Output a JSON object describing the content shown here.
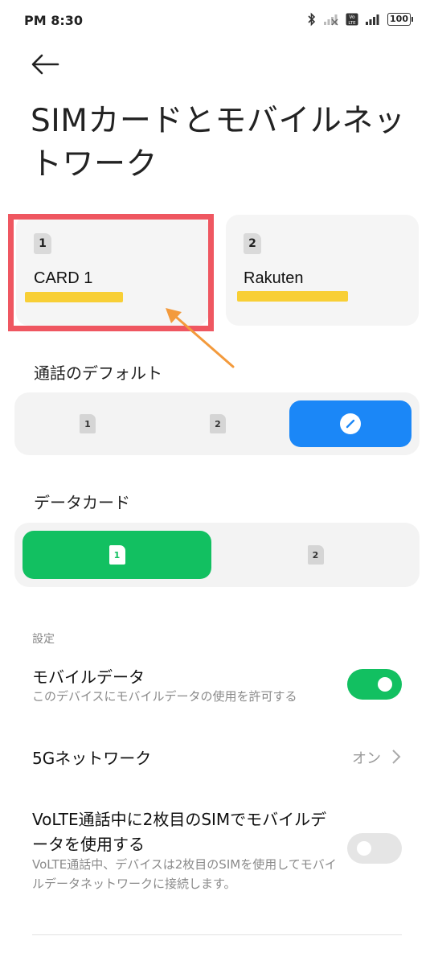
{
  "status_bar": {
    "time": "PM 8:30",
    "battery": "100"
  },
  "page": {
    "title": "SIMカードとモバイルネットワーク"
  },
  "sim_cards": [
    {
      "slot": "1",
      "name": "CARD 1"
    },
    {
      "slot": "2",
      "name": "Rakuten"
    }
  ],
  "default_calls": {
    "label": "通話のデフォルト",
    "options": [
      "1",
      "2"
    ],
    "selected": "ask-every-time"
  },
  "data_card": {
    "label": "データカード",
    "options": [
      "1",
      "2"
    ],
    "selected": "1"
  },
  "settings": {
    "group_label": "設定",
    "mobile_data": {
      "title": "モバイルデータ",
      "subtitle": "このデバイスにモバイルデータの使用を許可する",
      "enabled": true
    },
    "network_5g": {
      "title": "5Gネットワーク",
      "value": "オン"
    },
    "volte_data": {
      "title": "VoLTE通話中に2枚目のSIMでモバイルデータを使用する",
      "subtitle": "VoLTE通話中、デバイスは2枚目のSIMを使用してモバイルデータネットワークに接続します。",
      "enabled": false
    }
  },
  "colors": {
    "blue": "#1b87f7",
    "green": "#12c061",
    "annotation_red": "#ef5761",
    "annotation_arrow": "#f39a3c",
    "redaction_yellow": "#f8cf36"
  }
}
